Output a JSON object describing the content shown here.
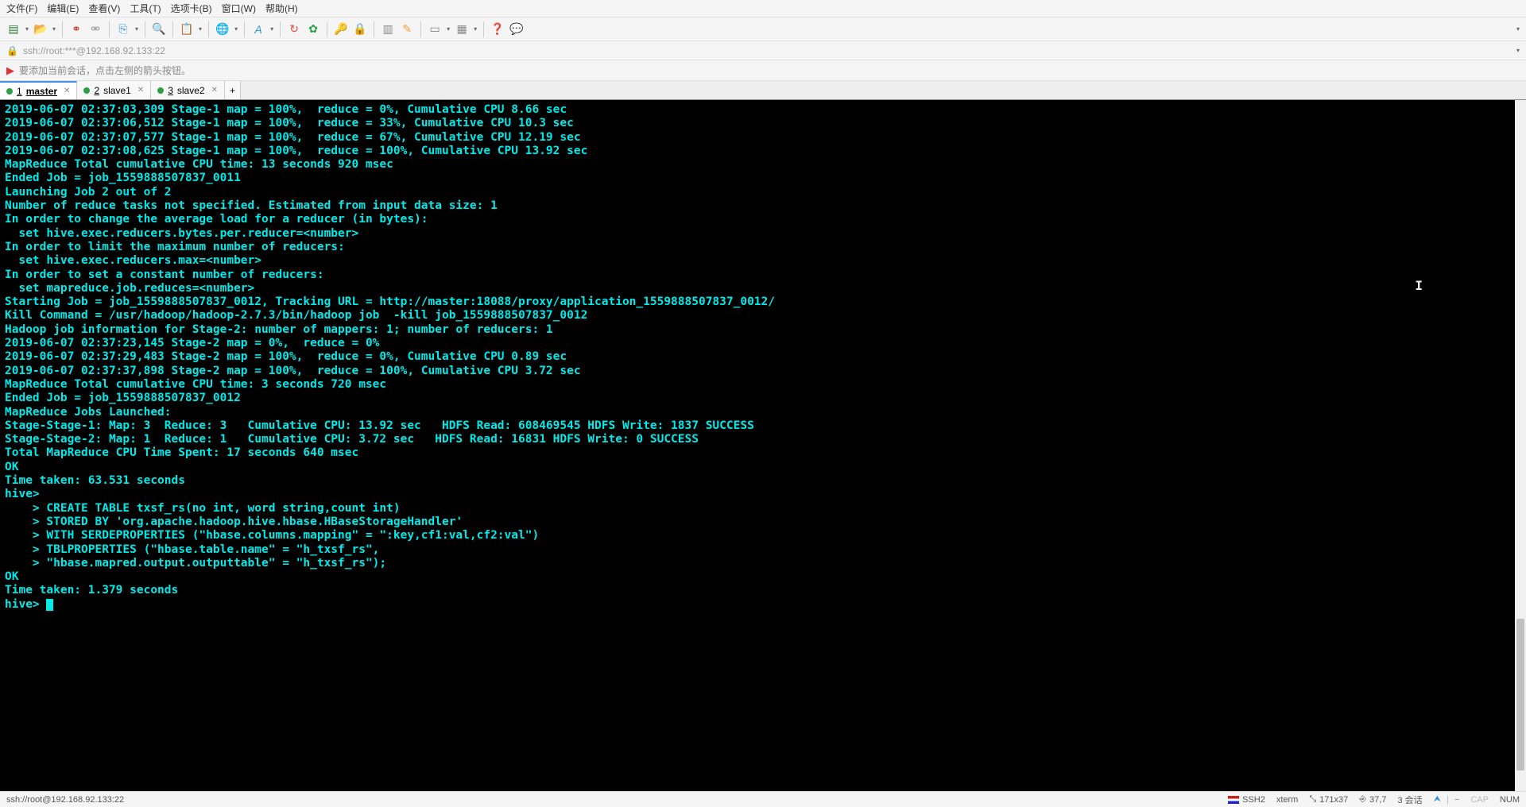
{
  "menu": {
    "file": "文件(F)",
    "edit": "编辑(E)",
    "view": "查看(V)",
    "tools": "工具(T)",
    "tabs": "选项卡(B)",
    "window": "窗口(W)",
    "help": "帮助(H)"
  },
  "address": "ssh://root:***@192.168.92.133:22",
  "hint": "要添加当前会话，点击左侧的箭头按钮。",
  "tabs": [
    {
      "num": "1",
      "label": "master",
      "active": true
    },
    {
      "num": "2",
      "label": "slave1",
      "active": false
    },
    {
      "num": "3",
      "label": "slave2",
      "active": false
    }
  ],
  "terminal_lines": [
    "2019-06-07 02:37:03,309 Stage-1 map = 100%,  reduce = 0%, Cumulative CPU 8.66 sec",
    "2019-06-07 02:37:06,512 Stage-1 map = 100%,  reduce = 33%, Cumulative CPU 10.3 sec",
    "2019-06-07 02:37:07,577 Stage-1 map = 100%,  reduce = 67%, Cumulative CPU 12.19 sec",
    "2019-06-07 02:37:08,625 Stage-1 map = 100%,  reduce = 100%, Cumulative CPU 13.92 sec",
    "MapReduce Total cumulative CPU time: 13 seconds 920 msec",
    "Ended Job = job_1559888507837_0011",
    "Launching Job 2 out of 2",
    "Number of reduce tasks not specified. Estimated from input data size: 1",
    "In order to change the average load for a reducer (in bytes):",
    "  set hive.exec.reducers.bytes.per.reducer=<number>",
    "In order to limit the maximum number of reducers:",
    "  set hive.exec.reducers.max=<number>",
    "In order to set a constant number of reducers:",
    "  set mapreduce.job.reduces=<number>",
    "Starting Job = job_1559888507837_0012, Tracking URL = http://master:18088/proxy/application_1559888507837_0012/",
    "Kill Command = /usr/hadoop/hadoop-2.7.3/bin/hadoop job  -kill job_1559888507837_0012",
    "Hadoop job information for Stage-2: number of mappers: 1; number of reducers: 1",
    "2019-06-07 02:37:23,145 Stage-2 map = 0%,  reduce = 0%",
    "2019-06-07 02:37:29,483 Stage-2 map = 100%,  reduce = 0%, Cumulative CPU 0.89 sec",
    "2019-06-07 02:37:37,898 Stage-2 map = 100%,  reduce = 100%, Cumulative CPU 3.72 sec",
    "MapReduce Total cumulative CPU time: 3 seconds 720 msec",
    "Ended Job = job_1559888507837_0012",
    "MapReduce Jobs Launched: ",
    "Stage-Stage-1: Map: 3  Reduce: 3   Cumulative CPU: 13.92 sec   HDFS Read: 608469545 HDFS Write: 1837 SUCCESS",
    "Stage-Stage-2: Map: 1  Reduce: 1   Cumulative CPU: 3.72 sec   HDFS Read: 16831 HDFS Write: 0 SUCCESS",
    "Total MapReduce CPU Time Spent: 17 seconds 640 msec",
    "OK",
    "Time taken: 63.531 seconds",
    "hive> ",
    "    > CREATE TABLE txsf_rs(no int, word string,count int)",
    "    > STORED BY 'org.apache.hadoop.hive.hbase.HBaseStorageHandler'",
    "    > WITH SERDEPROPERTIES (\"hbase.columns.mapping\" = \":key,cf1:val,cf2:val\")",
    "    > TBLPROPERTIES (\"hbase.table.name\" = \"h_txsf_rs\",",
    "    > \"hbase.mapred.output.outputtable\" = \"h_txsf_rs\");",
    "OK",
    "Time taken: 1.379 seconds"
  ],
  "prompt": "hive> ",
  "status": {
    "left": "ssh://root@192.168.92.133:22",
    "ssh": "SSH2",
    "term": "xterm",
    "size": "171x37",
    "pos": "37,7",
    "sessions": "3 会话",
    "cap": "CAP",
    "num": "NUM"
  }
}
